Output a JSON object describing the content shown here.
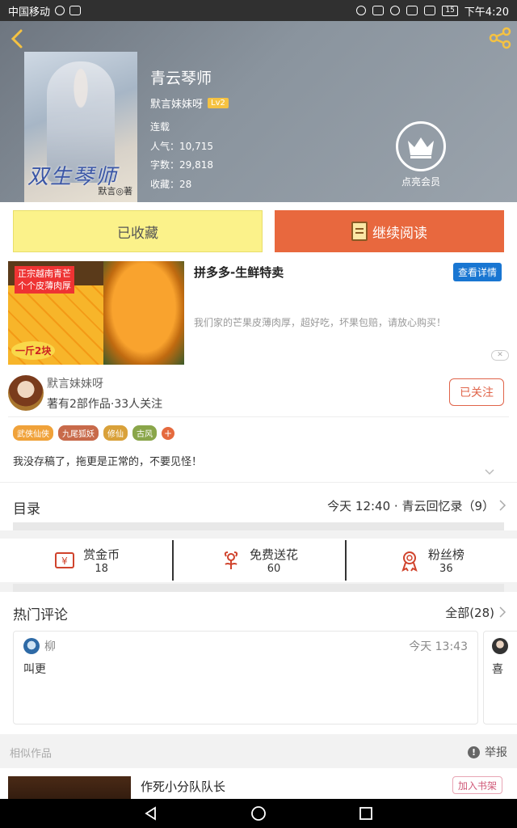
{
  "status_bar": {
    "carrier": "中国移动",
    "battery": "15",
    "time": "下午4:20"
  },
  "book": {
    "title": "青云琴师",
    "author": "默言妹妹呀",
    "level": "Lv2",
    "status": "连载",
    "popularity": "人气：10,715",
    "word_count": "字数：29,818",
    "favorites": "收藏：28",
    "cover_title": "双生琴师",
    "cover_author": "默言◎著"
  },
  "vip": {
    "label": "点亮会员"
  },
  "actions": {
    "collected": "已收藏",
    "continue_read": "继续阅读"
  },
  "ad": {
    "title": "拼多多-生鲜特卖",
    "detail_button": "查看详情",
    "description": "我们家的芒果皮薄肉厚，超好吃，坏果包赔，请放心购买！",
    "image_tag_line1": "正宗越南青芒",
    "image_tag_line2": "个个皮薄肉厚",
    "image_price": "一斤2块"
  },
  "author_section": {
    "name": "默言妹妹呀",
    "stats": "著有2部作品·33人关注",
    "follow_button": "已关注",
    "tags": [
      {
        "label": "武侠仙侠",
        "color": "#f0a23a"
      },
      {
        "label": "九尾狐妖",
        "color": "#c86a4a"
      },
      {
        "label": "修仙",
        "color": "#d9a13a"
      },
      {
        "label": "古风",
        "color": "#8aa64a"
      }
    ],
    "tag_add": "+",
    "description": "我没存稿了，拖更是正常的，不要见怪！"
  },
  "catalog": {
    "label": "目录",
    "latest": "今天 12:40 · 青云回忆录（9）"
  },
  "stats": [
    {
      "name": "赏金币",
      "value": "18",
      "icon": "coin-icon"
    },
    {
      "name": "免费送花",
      "value": "60",
      "icon": "flower-icon"
    },
    {
      "name": "粉丝榜",
      "value": "36",
      "icon": "medal-icon"
    }
  ],
  "hot_comments": {
    "title": "热门评论",
    "all": "全部(28)",
    "comments": [
      {
        "user": "柳",
        "time": "今天 13:43",
        "text": "叫更"
      },
      {
        "text": "喜"
      }
    ]
  },
  "similar": {
    "label": "相似作品",
    "report": "举报",
    "items": [
      {
        "title": "作死小分队队长",
        "add_button": "加入书架"
      }
    ]
  },
  "colors": {
    "accent_orange": "#e8683e",
    "collected_yellow": "#fbf28a",
    "ad_blue": "#1976d2"
  }
}
